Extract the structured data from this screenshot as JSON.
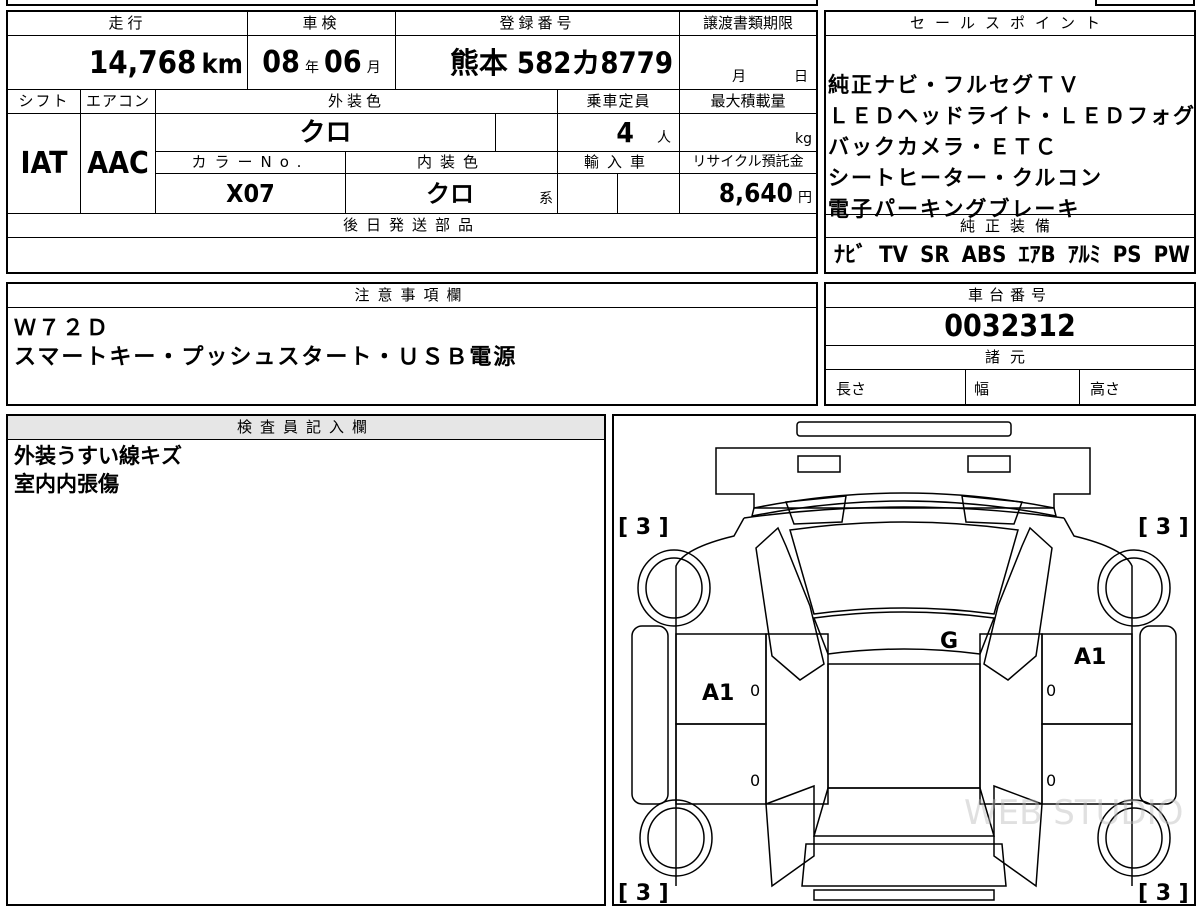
{
  "vehicle": {
    "mileage_label": "走行",
    "mileage_value": "14,768",
    "mileage_unit": "km",
    "inspection_label": "車検",
    "inspection_year": "08",
    "inspection_year_unit": "年",
    "inspection_month": "06",
    "inspection_month_unit": "月",
    "registration_label": "登録番号",
    "registration_value": "熊本 582カ8779",
    "transfer_deadline_label": "譲渡書類期限",
    "transfer_month_unit": "月",
    "transfer_day_unit": "日",
    "shift_label": "シフト",
    "shift_value": "IAT",
    "aircon_label": "エアコン",
    "aircon_value": "AAC",
    "exterior_color_label": "外装色",
    "exterior_color_value": "クロ",
    "capacity_label": "乗車定員",
    "capacity_value": "4",
    "capacity_unit": "人",
    "max_load_label": "最大積載量",
    "max_load_unit": "kg",
    "color_no_label": "カラーNo.",
    "color_no_value": "X07",
    "interior_color_label": "内装色",
    "interior_color_value": "クロ",
    "interior_color_suffix": "系",
    "import_label": "輸入車",
    "recycle_label": "リサイクル預託金",
    "recycle_value": "8,640",
    "recycle_unit": "円",
    "later_parts_label": "後日発送部品"
  },
  "sales_point": {
    "label": "セールスポイント",
    "lines": [
      "純正ナビ・フルセグＴＶ",
      "ＬＥＤヘッドライト・ＬＥＤフォグ",
      "バックカメラ・ＥＴＣ",
      "シートヒーター・クルコン",
      "電子パーキングブレーキ"
    ]
  },
  "equipment": {
    "label": "純正装備",
    "items": [
      "ﾅﾋﾞ",
      "TV",
      "SR",
      "ABS",
      "ｴｱB",
      "ｱﾙﾐ",
      "PS",
      "PW"
    ]
  },
  "notes": {
    "label": "注意事項欄",
    "lines": [
      "Ｗ７２Ｄ",
      "スマートキー・プッシュスタート・ＵＳＢ電源"
    ]
  },
  "chassis": {
    "label": "車台番号",
    "value": "0032312",
    "specs_label": "諸元",
    "length_label": "長さ",
    "width_label": "幅",
    "height_label": "高さ"
  },
  "inspector": {
    "label": "検査員記入欄",
    "lines": [
      "外装うすい線キズ",
      "室内内張傷"
    ]
  },
  "diagram": {
    "tire_tl": "[ 3 ]",
    "tire_tr": "[ 3 ]",
    "tire_bl": "[ 3 ]",
    "tire_br": "[ 3 ]",
    "mark_g": "G",
    "mark_a1_left": "A1",
    "mark_a1_right": "A1",
    "zero": "0",
    "watermark": "WEB STUDIO PRO"
  }
}
